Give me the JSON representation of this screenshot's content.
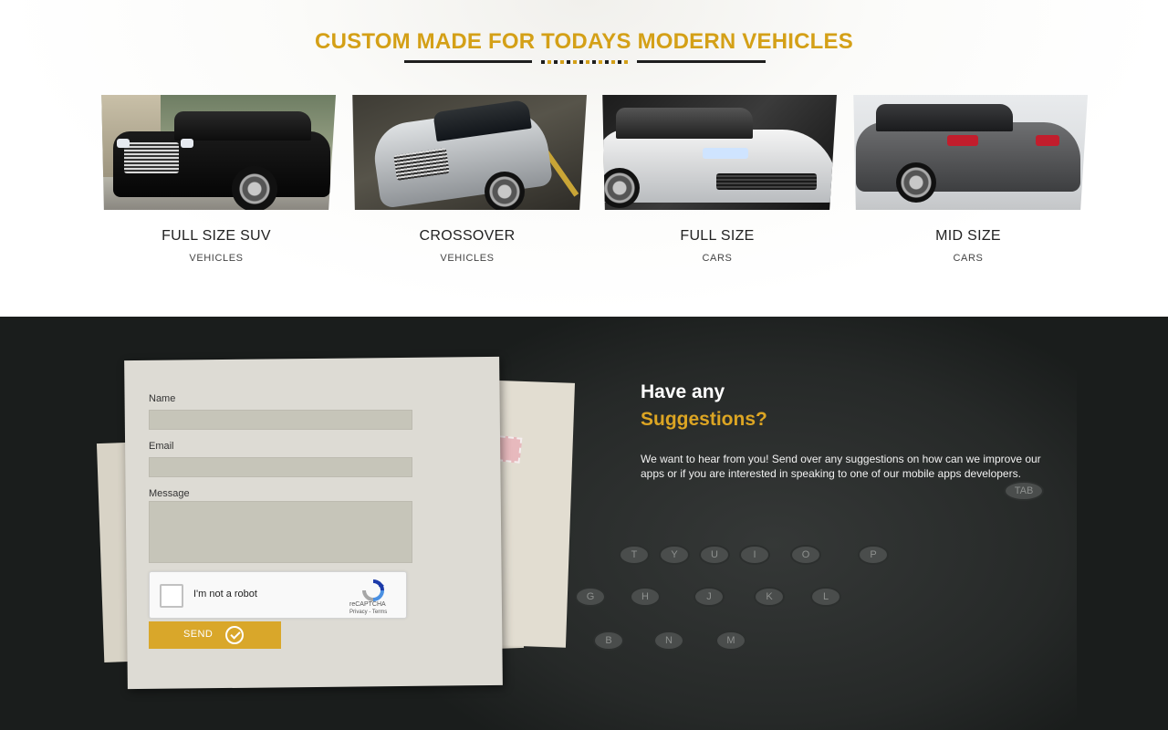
{
  "section_top": {
    "headline": "CUSTOM MADE FOR TODAYS MODERN VEHICLES",
    "cards": [
      {
        "title": "FULL SIZE SUV",
        "subtitle": "VEHICLES"
      },
      {
        "title": "CROSSOVER",
        "subtitle": "VEHICLES"
      },
      {
        "title": "FULL SIZE",
        "subtitle": "CARS"
      },
      {
        "title": "MID SIZE",
        "subtitle": "CARS"
      }
    ]
  },
  "contact": {
    "fields": {
      "name_label": "Name",
      "email_label": "Email",
      "message_label": "Message",
      "name_value": "",
      "email_value": "",
      "message_value": ""
    },
    "recaptcha": {
      "label": "I'm not a robot",
      "brand": "reCAPTCHA",
      "terms": "Privacy - Terms"
    },
    "send_label": "SEND",
    "heading_line1": "Have any",
    "heading_line2": "Suggestions?",
    "paragraph": "We want to hear from you! Send over any suggestions on how can we improve our apps or if you are interested in speaking to one of our mobile apps developers."
  },
  "typewriter_keys": {
    "row1": [
      "T",
      "Y",
      "U",
      "I",
      "O",
      "P"
    ],
    "row2": [
      "G",
      "H",
      "J",
      "K",
      "L"
    ],
    "row3": [
      "B",
      "N",
      "M"
    ],
    "tab": "TAB"
  },
  "colors": {
    "accent": "#d4a017",
    "button": "#d9a72a",
    "dark_bg": "#1a1d1c",
    "paper": "#dddbd4"
  }
}
